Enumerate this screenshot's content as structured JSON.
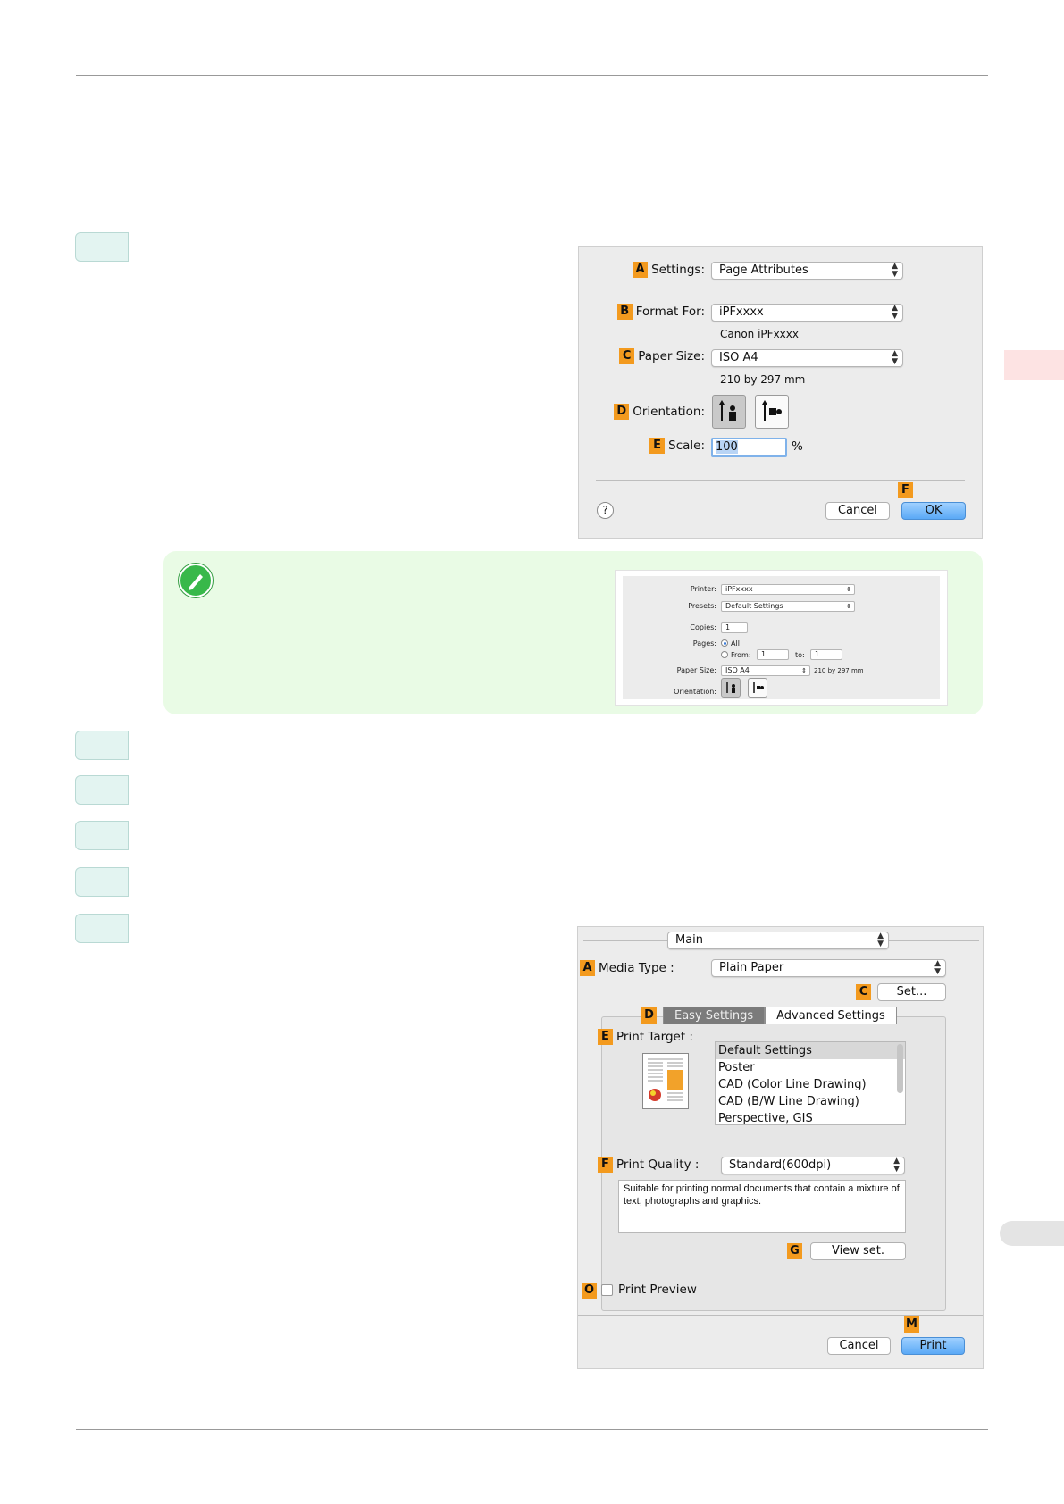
{
  "dialog_page_setup": {
    "settings_label": "Settings:",
    "settings_value": "Page Attributes",
    "format_label": "Format For:",
    "format_value": "iPFxxxx",
    "format_sub": "Canon iPFxxxx",
    "paper_label": "Paper Size:",
    "paper_value": "ISO A4",
    "paper_sub": "210 by 297 mm",
    "orientation_label": "Orientation:",
    "scale_label": "Scale:",
    "scale_value": "100",
    "scale_unit": "%",
    "help_label": "?",
    "cancel_label": "Cancel",
    "ok_label": "OK",
    "badges": {
      "a": "A",
      "b": "B",
      "c": "C",
      "d": "D",
      "e": "E",
      "f": "F"
    }
  },
  "note_dialog": {
    "printer_label": "Printer:",
    "printer_value": "iPFxxxx",
    "presets_label": "Presets:",
    "presets_value": "Default Settings",
    "copies_label": "Copies:",
    "copies_value": "1",
    "pages_label": "Pages:",
    "pages_all": "All",
    "pages_from": "From:",
    "pages_from_value": "1",
    "pages_to": "to:",
    "pages_to_value": "1",
    "paper_label": "Paper Size:",
    "paper_value": "ISO A4",
    "paper_sub": "210 by 297 mm",
    "orientation_label": "Orientation:"
  },
  "dialog_print": {
    "panel_value": "Main",
    "media_label": "Media Type :",
    "media_value": "Plain Paper",
    "set_label": "Set...",
    "tab_easy": "Easy Settings",
    "tab_advanced": "Advanced Settings",
    "target_label": "Print Target :",
    "targets": [
      "Default Settings",
      "Poster",
      "CAD (Color Line Drawing)",
      "CAD (B/W Line Drawing)",
      "Perspective, GIS"
    ],
    "quality_label": "Print Quality :",
    "quality_value": "Standard(600dpi)",
    "description": "Suitable for printing normal documents that contain a mixture of text, photographs and graphics.",
    "view_set_label": "View set.",
    "preview_label": "Print Preview",
    "cancel_label": "Cancel",
    "print_label": "Print",
    "badges": {
      "a": "A",
      "c": "C",
      "d": "D",
      "e": "E",
      "f": "F",
      "g": "G",
      "o": "O",
      "m": "M"
    }
  }
}
